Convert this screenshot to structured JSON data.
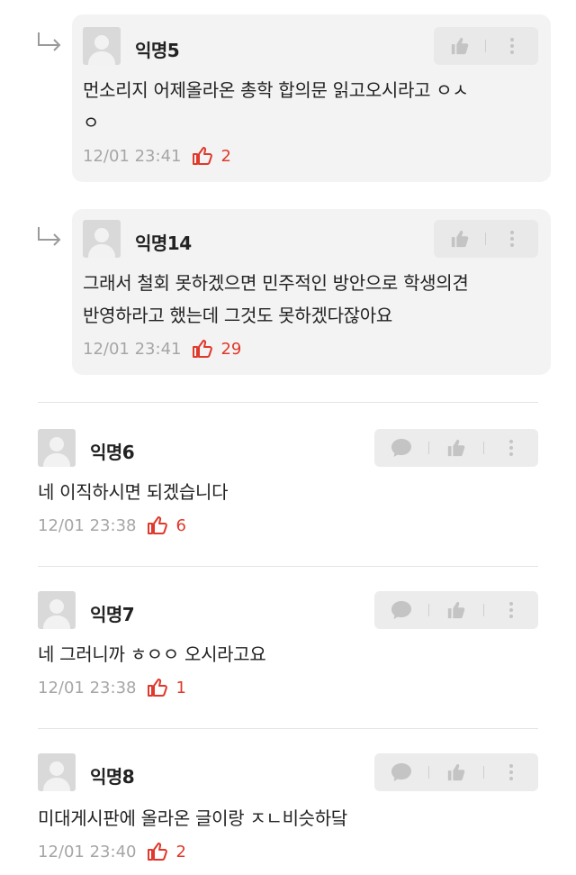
{
  "replies": [
    {
      "author": "익명5",
      "text_lines": [
        "먼소리지 어제올라온 총학 합의문 읽고오시라고 ㅇㅅ",
        "ㅇ"
      ],
      "time": "12/01 23:41",
      "likes": "2"
    },
    {
      "author": "익명14",
      "text_lines": [
        "그래서 철회 못하겠으면 민주적인 방안으로 학생의견",
        "반영하라고 했는데 그것도 못하겠다잖아요"
      ],
      "time": "12/01 23:41",
      "likes": "29"
    }
  ],
  "comments": [
    {
      "author": "익명6",
      "text": "네 이직하시면 되겠습니다",
      "time": "12/01 23:38",
      "likes": "6"
    },
    {
      "author": "익명7",
      "text": "네 그러니까 ㅎㅇㅇ 오시라고요",
      "time": "12/01 23:38",
      "likes": "1"
    },
    {
      "author": "익명8",
      "text": "미대게시판에 올라온 글이랑 ㅈㄴ비슷하닼",
      "time": "12/01 23:40",
      "likes": "2"
    }
  ],
  "colors": {
    "like": "#e0382b",
    "meta": "#a6a6a6",
    "reply_bg": "#f3f3f3",
    "action_icon": "#c4c4c4"
  },
  "icons": {
    "reply_arrow": "reply-arrow-icon",
    "thumb": "thumbs-up-icon",
    "kebab": "more-icon",
    "chat": "comment-icon",
    "heart": "heart-outline-icon"
  }
}
